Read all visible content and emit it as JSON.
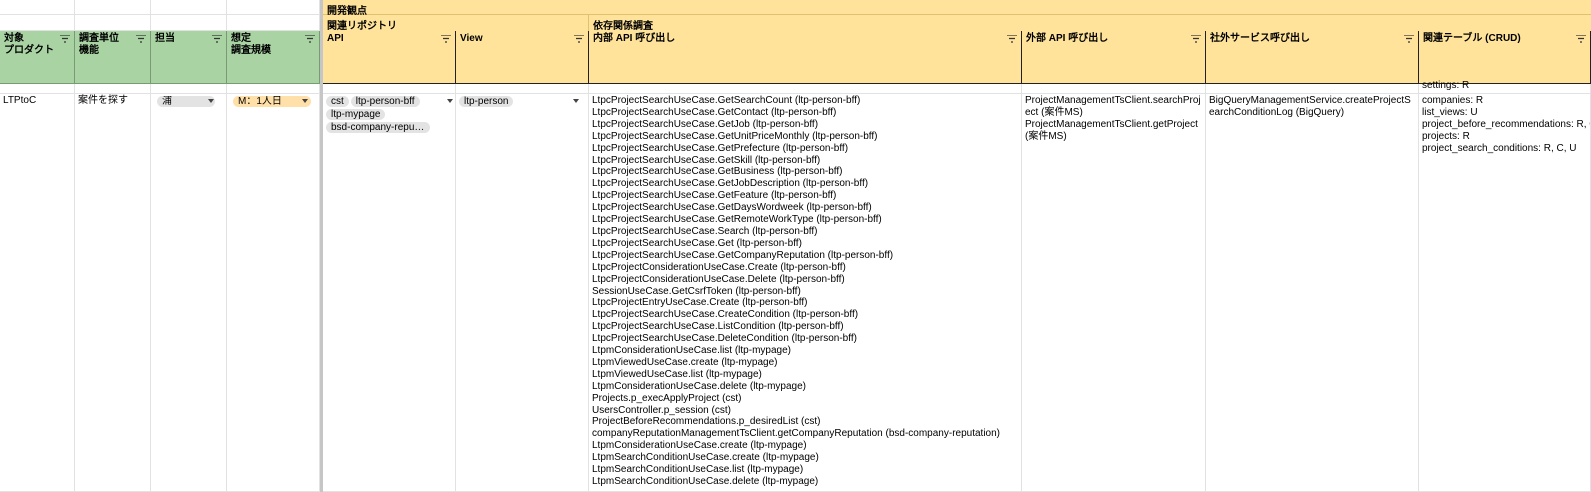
{
  "group_headers": {
    "dev_viewpoint": "開発観点",
    "related_repo": "関連リポジトリ",
    "dependency": "依存関係調査"
  },
  "columns": {
    "target_product": "対象\nプロダクト",
    "survey_unit": "調査単位\n機能",
    "owner": "担当",
    "estimate": "想定\n調査規模",
    "api": "API",
    "view": "View",
    "internal_api": "内部 API 呼び出し",
    "external_api": "外部 API 呼び出し",
    "external_service": "社外サービス呼び出し",
    "related_table": "関連テーブル (CRUD)"
  },
  "row": {
    "target_product": "LTPtoC",
    "survey_unit": "案件を探す",
    "owner": "浦",
    "estimate": "M：1人日",
    "api_chips": [
      "cst",
      "ltp-person-bff",
      "ltp-mypage",
      "bsd-company-reput…"
    ],
    "view_chips": [
      "ltp-person"
    ],
    "internal_api_calls": [
      "LtpcProjectSearchUseCase.GetSearchCount (ltp-person-bff)",
      "LtpcProjectSearchUseCase.GetContact (ltp-person-bff)",
      "LtpcProjectSearchUseCase.GetJob (ltp-person-bff)",
      "LtpcProjectSearchUseCase.GetUnitPriceMonthly (ltp-person-bff)",
      "LtpcProjectSearchUseCase.GetPrefecture (ltp-person-bff)",
      "LtpcProjectSearchUseCase.GetSkill (ltp-person-bff)",
      "LtpcProjectSearchUseCase.GetBusiness (ltp-person-bff)",
      "LtpcProjectSearchUseCase.GetJobDescription (ltp-person-bff)",
      "LtpcProjectSearchUseCase.GetFeature (ltp-person-bff)",
      "LtpcProjectSearchUseCase.GetDaysWordweek (ltp-person-bff)",
      "LtpcProjectSearchUseCase.GetRemoteWorkType (ltp-person-bff)",
      "LtpcProjectSearchUseCase.Search (ltp-person-bff)",
      "LtpcProjectSearchUseCase.Get (ltp-person-bff)",
      "LtpcProjectSearchUseCase.GetCompanyReputation (ltp-person-bff)",
      "LtpcProjectConsiderationUseCase.Create (ltp-person-bff)",
      "LtpcProjectConsiderationUseCase.Delete (ltp-person-bff)",
      "SessionUseCase.GetCsrfToken (ltp-person-bff)",
      "LtpcProjectEntryUseCase.Create (ltp-person-bff)",
      "LtpcProjectSearchUseCase.CreateCondition (ltp-person-bff)",
      "LtpcProjectSearchUseCase.ListCondition (ltp-person-bff)",
      "LtpcProjectSearchUseCase.DeleteCondition (ltp-person-bff)",
      "LtpmConsiderationUseCase.list (ltp-mypage)",
      "LtpmViewedUseCase.create (ltp-mypage)",
      "LtpmViewedUseCase.list (ltp-mypage)",
      "LtpmConsiderationUseCase.delete (ltp-mypage)",
      "Projects.p_execApplyProject (cst)",
      "UsersController.p_session (cst)",
      "ProjectBeforeRecommendations.p_desiredList (cst)",
      "companyReputationManagementTsClient.getCompanyReputation (bsd-company-reputation)",
      "LtpmConsiderationUseCase.create (ltp-mypage)",
      "LtpmSearchConditionUseCase.create (ltp-mypage)",
      "LtpmSearchConditionUseCase.list (ltp-mypage)",
      "LtpmSearchConditionUseCase.delete (ltp-mypage)"
    ],
    "external_api_calls": "ProjectManagementTsClient.searchProject (案件MS)\nProjectManagementTsClient.getProject (案件MS)",
    "external_service_calls": "BigQueryManagementService.createProjectSearchConditionLog (BigQuery)",
    "related_tables_cut": "settings: R",
    "related_tables": [
      "companies: R",
      "list_views: U",
      "project_before_recommendations: R, C",
      "projects: R",
      "project_search_conditions: R, C, U"
    ]
  },
  "colors": {
    "header_green": "#a9d3a3",
    "header_yellow": "#ffe39a",
    "chip_gray": "#e3e3e3",
    "chip_orange": "#ffe0a8"
  }
}
